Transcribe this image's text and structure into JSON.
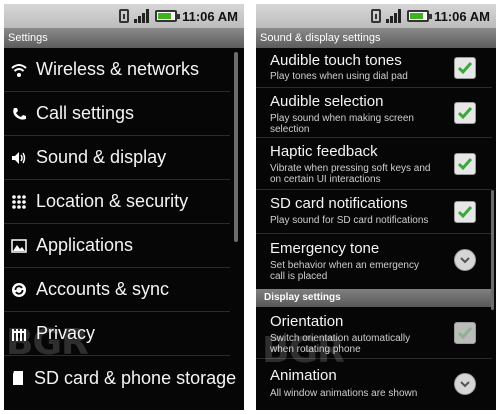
{
  "status_bar": {
    "time": "11:06 AM"
  },
  "left": {
    "title": "Settings",
    "items": [
      {
        "label": "Wireless & networks",
        "icon": "wifi-icon"
      },
      {
        "label": "Call settings",
        "icon": "phone-icon"
      },
      {
        "label": "Sound & display",
        "icon": "speaker-icon"
      },
      {
        "label": "Location & security",
        "icon": "grid-icon"
      },
      {
        "label": "Applications",
        "icon": "applications-icon"
      },
      {
        "label": "Accounts & sync",
        "icon": "sync-icon"
      },
      {
        "label": "Privacy",
        "icon": "privacy-icon"
      },
      {
        "label": "SD card & phone storage",
        "icon": "sd-card-icon"
      }
    ]
  },
  "right": {
    "title": "Sound & display settings",
    "items": [
      {
        "title": "Audible touch tones",
        "summary": "Play tones when using dial pad",
        "control": "checkbox-checked"
      },
      {
        "title": "Audible selection",
        "summary": "Play sound when making screen selection",
        "control": "checkbox-checked"
      },
      {
        "title": "Haptic feedback",
        "summary": "Vibrate when pressing soft keys and on certain UI interactions",
        "control": "checkbox-checked"
      },
      {
        "title": "SD card notifications",
        "summary": "Play sound for SD card notifications",
        "control": "checkbox-checked"
      },
      {
        "title": "Emergency tone",
        "summary": "Set behavior when an emergency call is placed",
        "control": "chevron"
      }
    ],
    "section_header": "Display settings",
    "items2": [
      {
        "title": "Orientation",
        "summary": "Switch orientation automatically when rotating phone",
        "control": "checkbox-checked-dim"
      },
      {
        "title": "Animation",
        "summary": "All window animations are shown",
        "control": "chevron"
      }
    ]
  },
  "watermark": {
    "left": "BGR",
    "right": "BGR"
  },
  "colors": {
    "check_green": "#3aa83a",
    "background": "#060606"
  }
}
